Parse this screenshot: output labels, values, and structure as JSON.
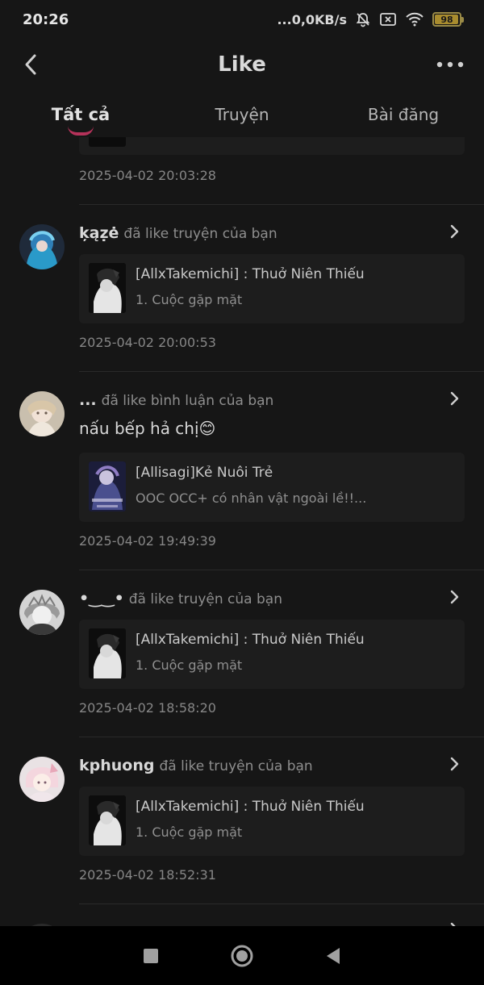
{
  "status_bar": {
    "time": "20:26",
    "network_speed": "...0,0KB/s",
    "battery_level": "98",
    "battery_fraction": 0.98,
    "icons": [
      "bell-off-icon",
      "sim-off-icon",
      "wifi-icon",
      "battery-icon"
    ]
  },
  "header": {
    "title": "Like",
    "back_icon": "back-arrow-icon",
    "more_icon": "more-dots-icon"
  },
  "tabs": [
    {
      "label": "Tất cả",
      "active": true
    },
    {
      "label": "Truyện",
      "active": false
    },
    {
      "label": "Bài đăng",
      "active": false
    }
  ],
  "accent_color": "#b5325a",
  "feed": [
    {
      "timestamp": "2025-04-02 20:03:28"
    },
    {
      "username": "ķąẓė",
      "action": "đã like truyện của bạn",
      "card_title": "[AllxTakemichi] : Thuở Niên Thiếu",
      "card_subtitle": "1. Cuộc gặp mặt",
      "timestamp": "2025-04-02 20:00:53"
    },
    {
      "username": "...",
      "action": "đã like bình luận của bạn",
      "comment": "nấu bếp hả chị😊",
      "card_title": "[Allisagi]Kẻ Nuôi Trẻ",
      "card_subtitle": "OOC OCC+ có nhân vật ngoài lề!!...",
      "timestamp": "2025-04-02 19:49:39"
    },
    {
      "username": "•‿‿•",
      "action": "đã like truyện của bạn",
      "card_title": "[AllxTakemichi] : Thuở Niên Thiếu",
      "card_subtitle": "1. Cuộc gặp mặt",
      "timestamp": "2025-04-02 18:58:20"
    },
    {
      "username": "kphuong",
      "action": "đã like truyện của bạn",
      "card_title": "[AllxTakemichi] : Thuở Niên Thiếu",
      "card_subtitle": "1. Cuộc gặp mặt",
      "timestamp": "2025-04-02 18:52:31"
    }
  ],
  "nav_bar": {
    "icons": [
      "recent-apps-icon",
      "home-icon",
      "back-triangle-icon"
    ]
  }
}
